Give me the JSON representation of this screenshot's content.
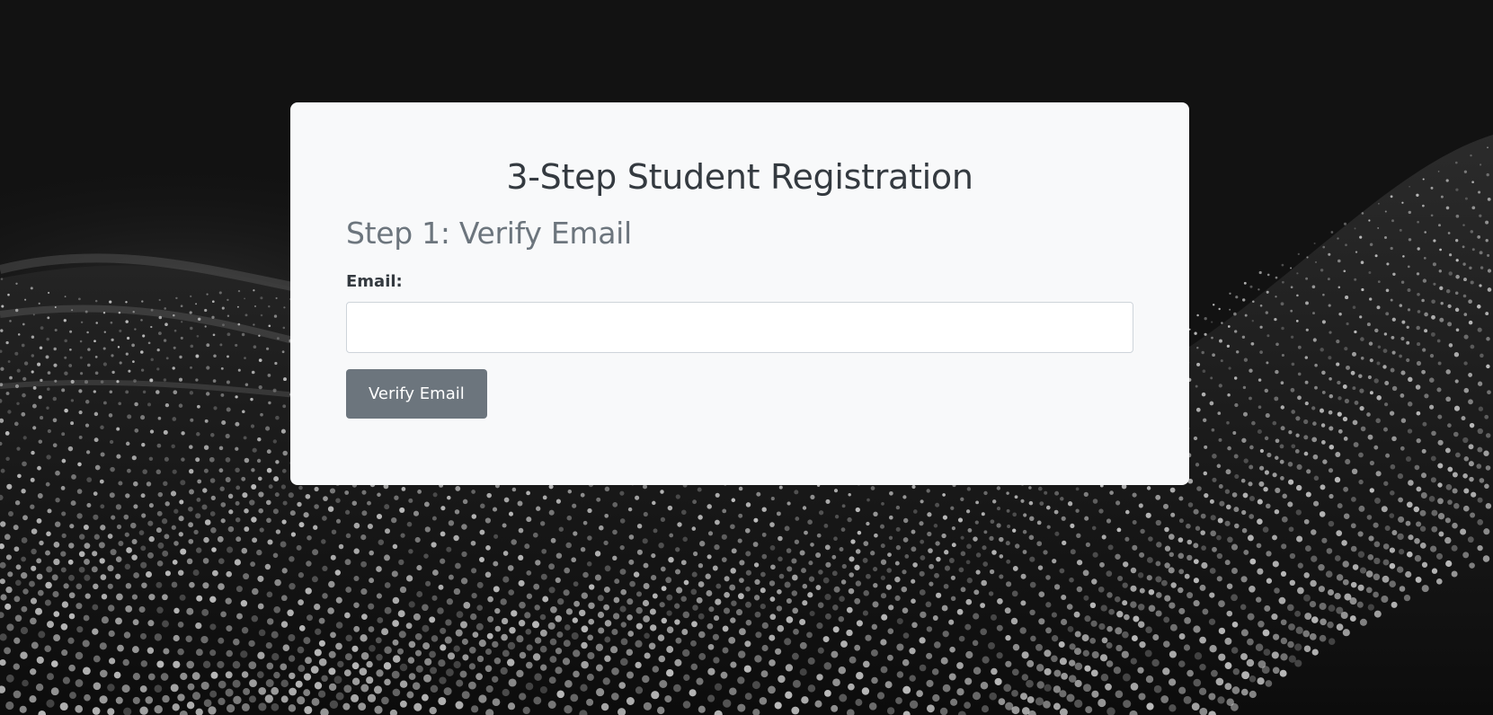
{
  "page": {
    "title": "3-Step Student Registration",
    "background_color": "#121212"
  },
  "step": {
    "heading": "Step 1: Verify Email"
  },
  "form": {
    "email_label": "Email:",
    "email_value": "",
    "email_placeholder": "",
    "verify_button_label": "Verify Email"
  },
  "colors": {
    "card_background": "#f8f9fa",
    "title_text": "#343a40",
    "step_text": "#6c757d",
    "button_background": "#6c757d",
    "button_text": "#ffffff"
  }
}
